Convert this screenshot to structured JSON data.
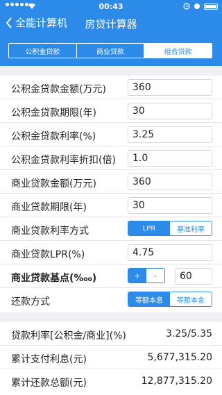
{
  "status_bar": {
    "time": "00:43"
  },
  "nav": {
    "back_label": "全能计算机",
    "title": "房贷计算器"
  },
  "tabs": [
    {
      "label": "公积金贷款",
      "active": false
    },
    {
      "label": "商业贷款",
      "active": false
    },
    {
      "label": "组合贷款",
      "active": true
    }
  ],
  "form": {
    "fund_amount": {
      "label": "公积金贷款金额(万元)",
      "value": "360"
    },
    "fund_term": {
      "label": "公积金贷款期限(年)",
      "value": "30"
    },
    "fund_rate": {
      "label": "公积金贷款利率(%)",
      "value": "3.25"
    },
    "fund_discount": {
      "label": "公积金贷款利率折扣(倍)",
      "value": "1.0"
    },
    "biz_amount": {
      "label": "商业贷款金额(万元)",
      "value": "360"
    },
    "biz_term": {
      "label": "商业贷款期限(年)",
      "value": "30"
    },
    "biz_rate_mode": {
      "label": "商业贷款利率方式",
      "options": [
        "LPR",
        "基准利率"
      ],
      "selected": "LPR"
    },
    "biz_lpr": {
      "label": "商业贷款LPR(%)",
      "value": "4.75"
    },
    "biz_basis": {
      "label": "商业贷款基点(‱)",
      "plus": "+",
      "minus": "-",
      "value": "60"
    },
    "repay_mode": {
      "label": "还款方式",
      "options": [
        "等额本息",
        "等额本金"
      ],
      "selected": "等额本息"
    }
  },
  "results": {
    "rate": {
      "label": "贷款利率[公积金/商业](%)",
      "value": "3.25/5.35"
    },
    "interest": {
      "label": "累计支付利息(元)",
      "value": "5,677,315.20"
    },
    "total": {
      "label": "累计还款总额(元)",
      "value": "12,877,315.20"
    }
  },
  "colors": {
    "accent": "#2c8ae8",
    "background": "#efeff4"
  }
}
